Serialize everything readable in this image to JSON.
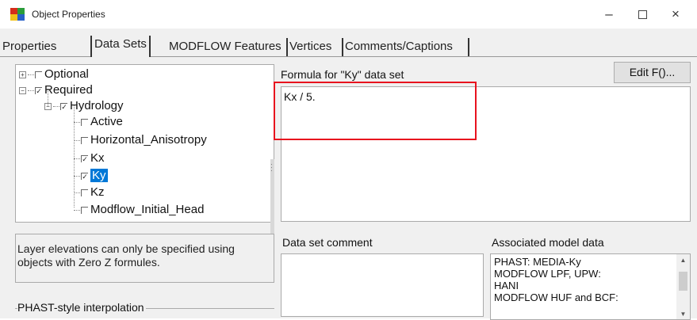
{
  "window": {
    "title": "Object Properties",
    "minimize": "–",
    "close": "×"
  },
  "tabs": [
    "Properties",
    "Data Sets",
    "MODFLOW Features",
    "Vertices",
    "Comments/Captions"
  ],
  "active_tab": "Data Sets",
  "tree": {
    "optional": "Optional",
    "required": "Required",
    "hydrology": "Hydrology",
    "items": [
      {
        "label": "Active",
        "checked": false
      },
      {
        "label": "Horizontal_Anisotropy",
        "checked": false
      },
      {
        "label": "Kx",
        "checked": true
      },
      {
        "label": "Ky",
        "checked": true,
        "selected": true
      },
      {
        "label": "Kz",
        "checked": false
      },
      {
        "label": "Modflow_Initial_Head",
        "checked": false
      }
    ]
  },
  "message": "Layer elevations can only be specified using objects with Zero Z formules.",
  "formula": {
    "label": "Formula for \"Ky\" data set",
    "value": "Kx / 5.",
    "edit_button": "Edit F()..."
  },
  "comment": {
    "label": "Data set comment",
    "value": ""
  },
  "associated": {
    "label": "Associated model data",
    "lines": [
      "PHAST: MEDIA-Ky",
      "MODFLOW LPF, UPW:",
      "HANI",
      "MODFLOW HUF and BCF:"
    ]
  },
  "interpolation_group": "PHAST-style interpolation",
  "colors": {
    "selection": "#0078d7",
    "highlight_box": "#e8121e",
    "dialog_bg": "#f0f0f0"
  }
}
